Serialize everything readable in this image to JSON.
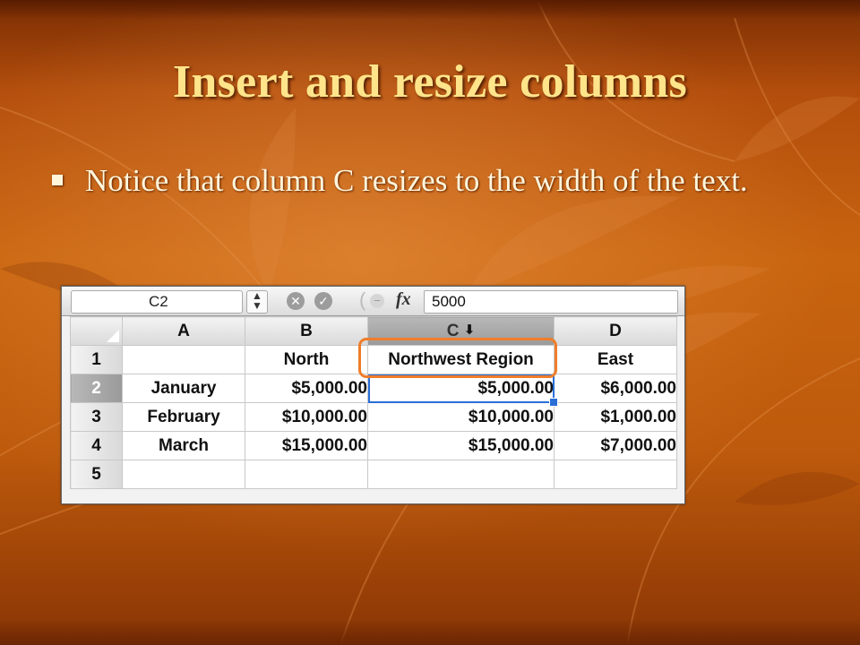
{
  "slide": {
    "title": "Insert and resize columns",
    "bullet": "Notice that column C resizes to the width of the text."
  },
  "spreadsheet": {
    "name_box": "C2",
    "formula_value": "5000",
    "fx_label": "fx",
    "active_cell": "C2",
    "highlighted_cell": "C1",
    "columns": [
      "A",
      "B",
      "C",
      "D"
    ],
    "rows": [
      {
        "num": "1",
        "cells": [
          "",
          "North",
          "Northwest Region",
          "East"
        ]
      },
      {
        "num": "2",
        "cells": [
          "January",
          "$5,000.00",
          "$5,000.00",
          "$6,000.00"
        ]
      },
      {
        "num": "3",
        "cells": [
          "February",
          "$10,000.00",
          "$10,000.00",
          "$1,000.00"
        ]
      },
      {
        "num": "4",
        "cells": [
          "March",
          "$15,000.00",
          "$15,000.00",
          "$7,000.00"
        ]
      },
      {
        "num": "5",
        "cells": [
          "",
          "",
          "",
          ""
        ]
      }
    ],
    "highlight_color": "#ef7d2a",
    "selection_color": "#2a6ed8"
  },
  "icons": [
    "bullet-square-icon",
    "stepper-icon",
    "cancel-icon",
    "confirm-icon",
    "fx-icon",
    "resize-arrow-icon",
    "select-all-icon"
  ],
  "colors": {
    "title": "#ffe48a",
    "body_text": "#fff6dc",
    "background": "#c8640f"
  }
}
